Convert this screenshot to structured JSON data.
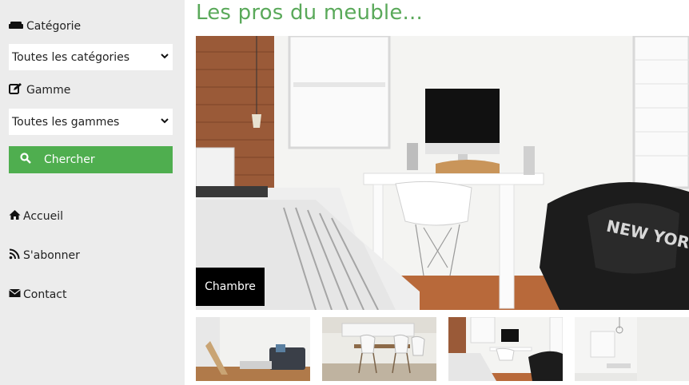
{
  "sidebar": {
    "category_label": "Catégorie",
    "category_select": "Toutes les catégories",
    "range_label": "Gamme",
    "range_select": "Toutes les gammes",
    "search_button": "Chercher",
    "nav": {
      "home": "Accueil",
      "subscribe": "S'abonner",
      "contact": "Contact"
    }
  },
  "main": {
    "title": "Les pros du meuble...",
    "hero_caption": "Chambre",
    "hero_pillow_text": "NEW YORK"
  },
  "colors": {
    "accent": "#4fae4f",
    "title": "#5aa95a",
    "sidebar_bg": "#ececec"
  },
  "icons": [
    "sofa-icon",
    "edit-icon",
    "search-icon",
    "home-icon",
    "rss-icon",
    "envelope-icon",
    "chevron-down-icon"
  ]
}
